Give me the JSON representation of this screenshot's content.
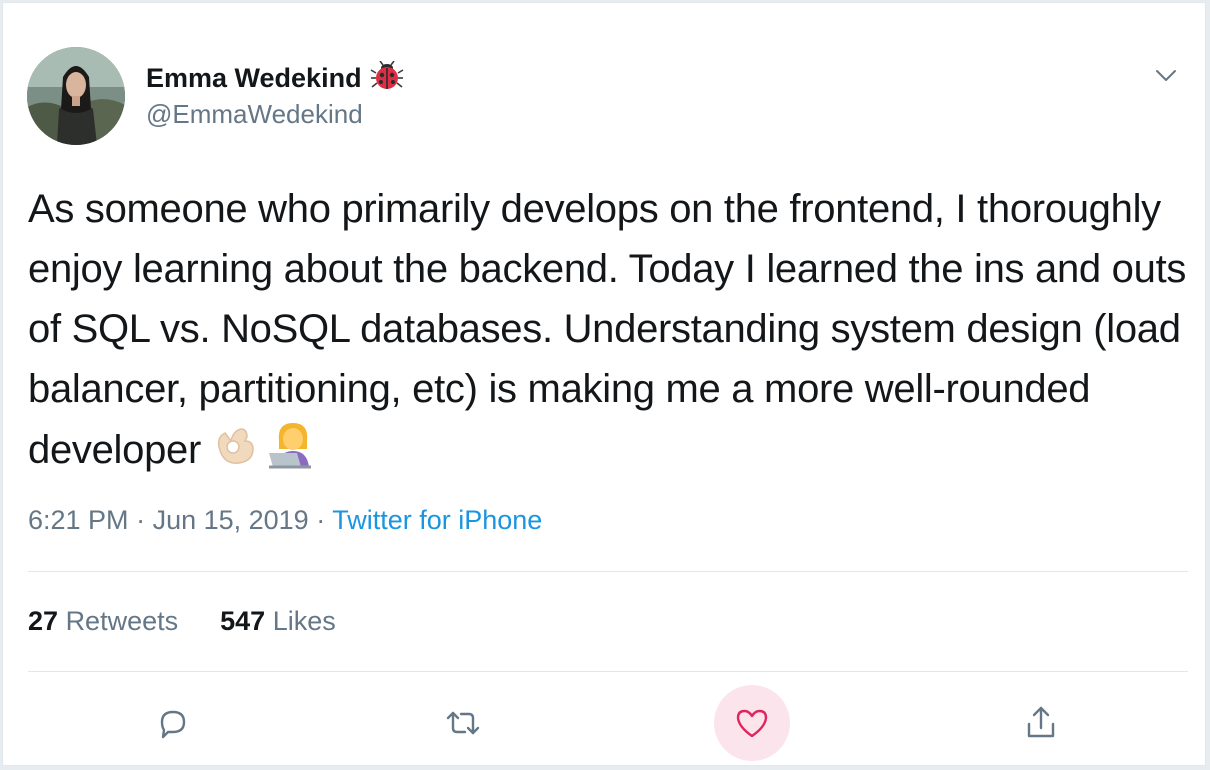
{
  "author": {
    "display_name": "Emma Wedekind",
    "handle": "@EmmaWedekind",
    "name_emoji": "ladybug-icon"
  },
  "tweet": {
    "text": "As someone who primarily develops on the frontend, I thoroughly enjoy learning about the backend. Today I learned the ins and outs of SQL vs. NoSQL databases. Understanding system design (load balancer, partitioning, etc) is making me a more well-rounded developer",
    "emojis": [
      "ok-hand-icon",
      "woman-technologist-icon"
    ]
  },
  "meta": {
    "time": "6:21 PM",
    "separator": " · ",
    "date": "Jun 15, 2019",
    "source": "Twitter for iPhone"
  },
  "stats": {
    "retweets_count": "27",
    "retweets_label": "Retweets",
    "likes_count": "547",
    "likes_label": "Likes"
  },
  "actions": [
    "reply-icon",
    "retweet-icon",
    "like-icon",
    "share-icon"
  ],
  "colors": {
    "text": "#14171a",
    "muted": "#657786",
    "link": "#1b95e0",
    "like": "#e0245e",
    "like_bg": "#fbe4ec",
    "border": "#e1e8ed"
  }
}
